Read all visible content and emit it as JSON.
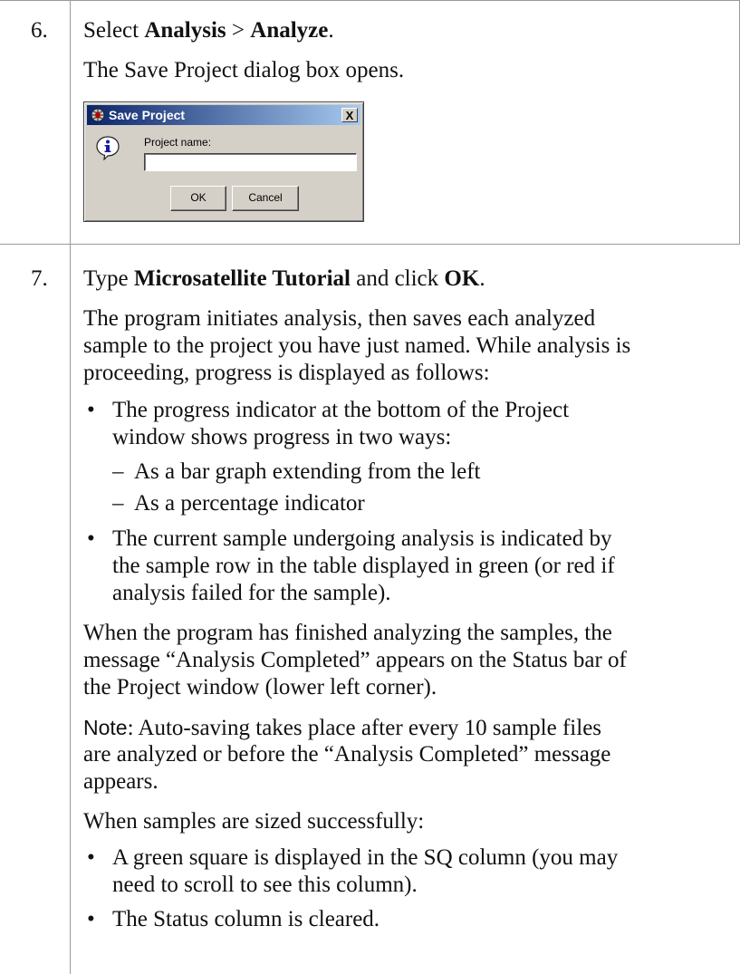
{
  "step6": {
    "number": "6.",
    "instruction_prefix": "Select ",
    "instruction_menu": "Analysis",
    "instruction_sep": " > ",
    "instruction_item": "Analyze",
    "instruction_end": ".",
    "result": "The Save Project dialog box opens.",
    "dialog": {
      "title": "Save Project",
      "close_label": "X",
      "field_label": "Project name:",
      "field_value": "",
      "ok_label": "OK",
      "cancel_label": "Cancel"
    }
  },
  "step7": {
    "number": "7.",
    "instruction_prefix": "Type ",
    "instruction_value": "Microsatellite Tutorial",
    "instruction_mid": " and click ",
    "instruction_button": "OK",
    "instruction_end": ".",
    "para1_lines": [
      "The program initiates analysis, then saves each analyzed",
      "sample to the project you have just named. While analysis is",
      "proceeding, progress is displayed as follows:"
    ],
    "bullet1_lines": [
      "The progress indicator at the bottom of the Project",
      "window shows progress in two ways:"
    ],
    "sub_bullets": [
      "As a bar graph extending from the left",
      "As a percentage indicator"
    ],
    "bullet2_lines": [
      "The current sample undergoing analysis is indicated by",
      "the sample row in the table displayed in green (or red if",
      "analysis failed for the sample)."
    ],
    "para2_lines": [
      "When the program has finished analyzing the samples, the",
      "message “Analysis Completed” appears on the Status bar of",
      "the Project window (lower left corner)."
    ],
    "note_label": "Note",
    "note_lines": [
      ":  Auto-saving takes place after every 10 sample files",
      "are analyzed or before the “Analysis Completed” message",
      "appears."
    ],
    "para3": "When samples are sized successfully:",
    "bullet3_lines": [
      "A green square is displayed in the SQ column (you may",
      "need to scroll to see this column)."
    ],
    "bullet4": "The Status column is cleared.",
    "bullet_char": "•",
    "dash_char": "–"
  }
}
